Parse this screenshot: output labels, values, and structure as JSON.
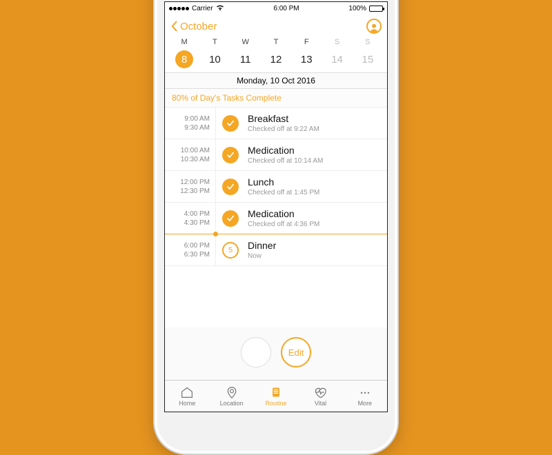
{
  "status_bar": {
    "carrier": "Carrier",
    "time": "6:00 PM",
    "battery": "100%"
  },
  "nav": {
    "back_label": "October"
  },
  "week": {
    "headers": [
      "M",
      "T",
      "W",
      "T",
      "F",
      "S",
      "S"
    ],
    "days": [
      {
        "n": "8",
        "selected": true,
        "dim": false
      },
      {
        "n": "10",
        "selected": false,
        "dim": false
      },
      {
        "n": "11",
        "selected": false,
        "dim": false
      },
      {
        "n": "12",
        "selected": false,
        "dim": false
      },
      {
        "n": "13",
        "selected": false,
        "dim": false
      },
      {
        "n": "14",
        "selected": false,
        "dim": true
      },
      {
        "n": "15",
        "selected": false,
        "dim": true
      }
    ]
  },
  "date_label": "Monday, 10 Oct 2016",
  "progress_label": "80% of Day's Tasks Complete",
  "tasks": [
    {
      "start": "9:00 AM",
      "end": "9:30 AM",
      "name": "Breakfast",
      "sub": "Checked off at 9:22 AM",
      "done": true
    },
    {
      "start": "10:00 AM",
      "end": "10:30 AM",
      "name": "Medication",
      "sub": "Checked off at 10:14 AM",
      "done": true
    },
    {
      "start": "12:00 PM",
      "end": "12:30 PM",
      "name": "Lunch",
      "sub": "Checked off at 1:45 PM",
      "done": true
    },
    {
      "start": "4:00 PM",
      "end": "4:30 PM",
      "name": "Medication",
      "sub": "Checked off at 4:36 PM",
      "done": true
    },
    {
      "start": "6:00 PM",
      "end": "6:30 PM",
      "name": "Dinner",
      "sub": "Now",
      "done": false,
      "badge": "5",
      "current": true
    }
  ],
  "actions": {
    "edit_label": "Edit"
  },
  "tabs": [
    {
      "label": "Home",
      "active": false
    },
    {
      "label": "Location",
      "active": false
    },
    {
      "label": "Routine",
      "active": true
    },
    {
      "label": "Vital",
      "active": false
    },
    {
      "label": "More",
      "active": false
    }
  ]
}
